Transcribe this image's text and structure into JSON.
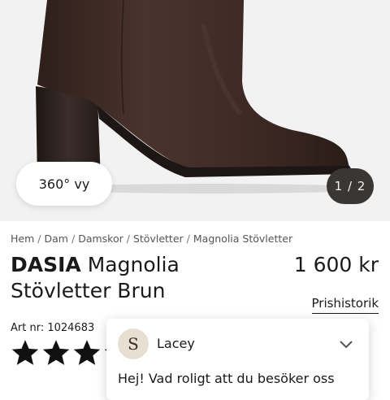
{
  "gallery": {
    "vy_label": "360° vy",
    "pager": "1 / 2"
  },
  "breadcrumb": {
    "items": [
      "Hem",
      "Dam",
      "Damskor",
      "Stövletter",
      "Magnolia Stövletter"
    ]
  },
  "product": {
    "brand": "DASIA",
    "title_rest": " Magnolia Stövletter Brun",
    "price": "1 600 kr",
    "price_history_label": "Prishistorik",
    "art_nr": "Art nr: 1024683",
    "rating_stars": 5
  },
  "chat": {
    "avatar_letter": "S",
    "agent_name": "Lacey",
    "message": "Hej! Vad roligt att du besöker oss"
  },
  "colors": {
    "boot_leather": "#3f2b26",
    "pager_bg": "#3a3634",
    "gallery_bg": "#f2f2f2"
  }
}
